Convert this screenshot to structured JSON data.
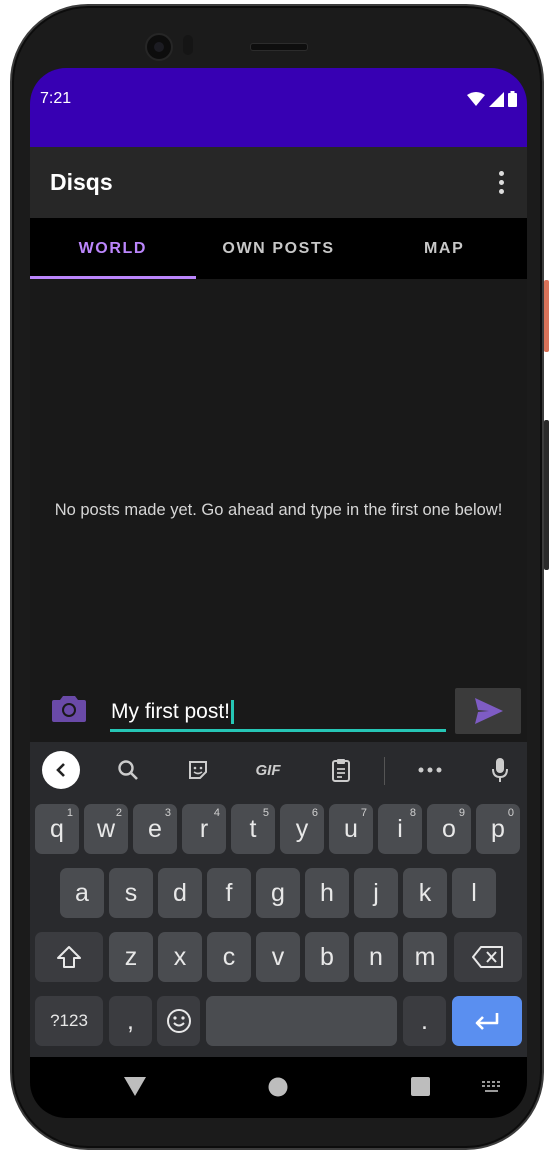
{
  "status": {
    "time": "7:21"
  },
  "app": {
    "title": "Disqs"
  },
  "tabs": [
    {
      "label": "WORLD",
      "active": true
    },
    {
      "label": "OWN POSTS",
      "active": false
    },
    {
      "label": "MAP",
      "active": false
    }
  ],
  "feed": {
    "empty_message": "No posts made yet. Go ahead and type in the first one below!"
  },
  "composer": {
    "input_value": "My first post!"
  },
  "keyboard": {
    "toolbar": {
      "gif_label": "GIF"
    },
    "row1": [
      {
        "k": "q",
        "h": "1"
      },
      {
        "k": "w",
        "h": "2"
      },
      {
        "k": "e",
        "h": "3"
      },
      {
        "k": "r",
        "h": "4"
      },
      {
        "k": "t",
        "h": "5"
      },
      {
        "k": "y",
        "h": "6"
      },
      {
        "k": "u",
        "h": "7"
      },
      {
        "k": "i",
        "h": "8"
      },
      {
        "k": "o",
        "h": "9"
      },
      {
        "k": "p",
        "h": "0"
      }
    ],
    "row2": [
      "a",
      "s",
      "d",
      "f",
      "g",
      "h",
      "j",
      "k",
      "l"
    ],
    "row3": [
      "z",
      "x",
      "c",
      "v",
      "b",
      "n",
      "m"
    ],
    "symbols_label": "?123",
    "comma": ",",
    "period": "."
  },
  "colors": {
    "status_bar": "#3700b3",
    "accent": "#bb86fc",
    "input_underline": "#26c6b5",
    "enter_key": "#5a8ff0"
  },
  "icons": [
    "wifi-icon",
    "signal-icon",
    "battery-icon",
    "overflow-menu-icon",
    "camera-icon",
    "send-icon",
    "back-icon",
    "search-icon",
    "sticker-icon",
    "clipboard-icon",
    "more-icon",
    "mic-icon",
    "shift-icon",
    "backspace-icon",
    "emoji-icon",
    "enter-icon",
    "nav-back-icon",
    "nav-home-icon",
    "nav-recents-icon",
    "keyboard-switch-icon"
  ]
}
